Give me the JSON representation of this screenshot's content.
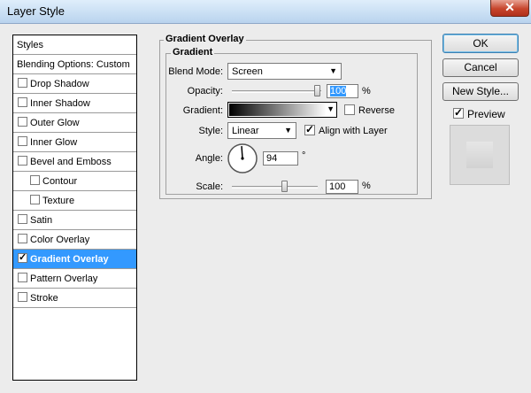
{
  "window": {
    "title": "Layer Style",
    "close_glyph": "✕"
  },
  "style_list": {
    "items": [
      {
        "label": "Styles",
        "has_checkbox": false,
        "checked": false,
        "selected": false,
        "indent": 0
      },
      {
        "label": "Blending Options: Custom",
        "has_checkbox": false,
        "checked": false,
        "selected": false,
        "indent": 0
      },
      {
        "label": "Drop Shadow",
        "has_checkbox": true,
        "checked": false,
        "selected": false,
        "indent": 0
      },
      {
        "label": "Inner Shadow",
        "has_checkbox": true,
        "checked": false,
        "selected": false,
        "indent": 0
      },
      {
        "label": "Outer Glow",
        "has_checkbox": true,
        "checked": false,
        "selected": false,
        "indent": 0
      },
      {
        "label": "Inner Glow",
        "has_checkbox": true,
        "checked": false,
        "selected": false,
        "indent": 0
      },
      {
        "label": "Bevel and Emboss",
        "has_checkbox": true,
        "checked": false,
        "selected": false,
        "indent": 0
      },
      {
        "label": "Contour",
        "has_checkbox": true,
        "checked": false,
        "selected": false,
        "indent": 1
      },
      {
        "label": "Texture",
        "has_checkbox": true,
        "checked": false,
        "selected": false,
        "indent": 1
      },
      {
        "label": "Satin",
        "has_checkbox": true,
        "checked": false,
        "selected": false,
        "indent": 0
      },
      {
        "label": "Color Overlay",
        "has_checkbox": true,
        "checked": false,
        "selected": false,
        "indent": 0
      },
      {
        "label": "Gradient Overlay",
        "has_checkbox": true,
        "checked": true,
        "selected": true,
        "indent": 0
      },
      {
        "label": "Pattern Overlay",
        "has_checkbox": true,
        "checked": false,
        "selected": false,
        "indent": 0
      },
      {
        "label": "Stroke",
        "has_checkbox": true,
        "checked": false,
        "selected": false,
        "indent": 0
      }
    ]
  },
  "panel": {
    "outer_title": "Gradient Overlay",
    "inner_title": "Gradient",
    "blend_mode": {
      "label": "Blend Mode:",
      "value": "Screen"
    },
    "opacity": {
      "label": "Opacity:",
      "value": "100",
      "unit": "%",
      "level": 1.0
    },
    "gradient": {
      "label": "Gradient:",
      "reverse_label": "Reverse",
      "reverse_checked": false
    },
    "style": {
      "label": "Style:",
      "value": "Linear",
      "align_label": "Align with Layer",
      "align_checked": true
    },
    "angle": {
      "label": "Angle:",
      "value": "94",
      "unit": "°"
    },
    "scale": {
      "label": "Scale:",
      "value": "100",
      "unit": "%"
    }
  },
  "buttons": {
    "ok": "OK",
    "cancel": "Cancel",
    "new_style": "New Style..."
  },
  "preview": {
    "label": "Preview",
    "checked": true
  },
  "colors": {
    "selection": "#3399ff",
    "dialog_bg": "#ececec"
  }
}
